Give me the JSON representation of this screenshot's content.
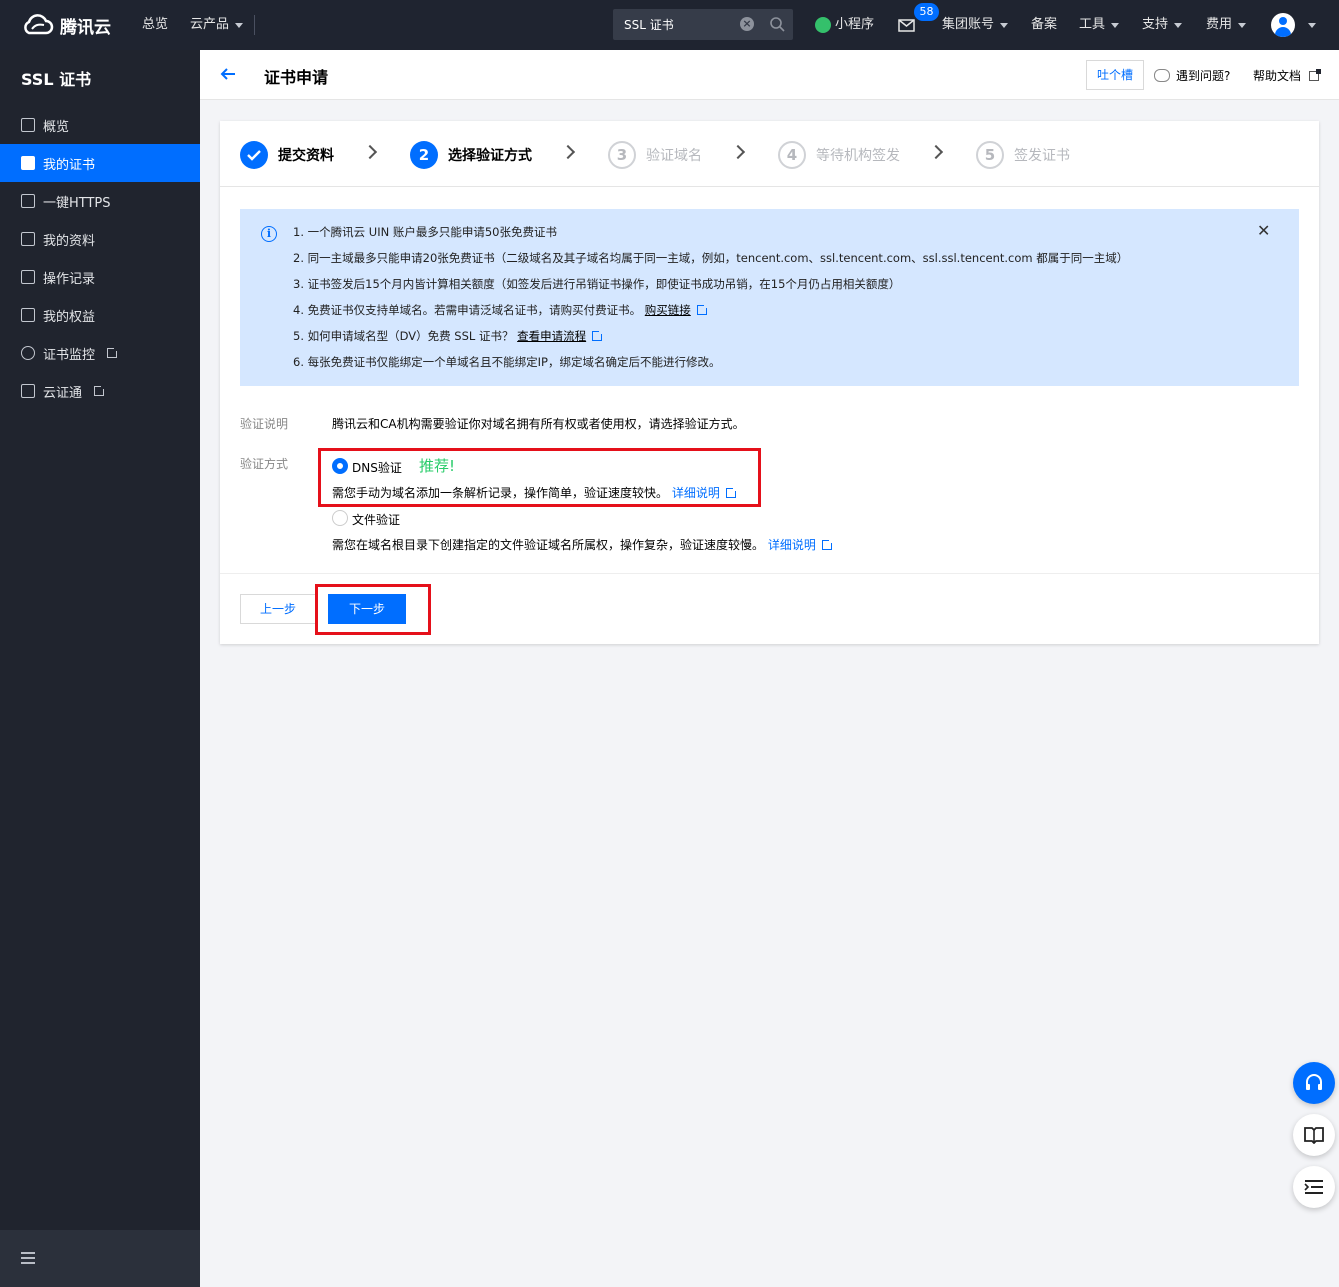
{
  "topbar": {
    "brand": "腾讯云",
    "nav": {
      "overview": "总览",
      "products": "云产品"
    },
    "search": {
      "value": "SSL 证书"
    },
    "miniprogram": "小程序",
    "mail_badge": "58",
    "group_account": "集团账号",
    "beian": "备案",
    "tools": "工具",
    "support": "支持",
    "billing": "费用"
  },
  "sidebar": {
    "title": "SSL 证书",
    "items": [
      {
        "label": "概览"
      },
      {
        "label": "我的证书"
      },
      {
        "label": "一键HTTPS"
      },
      {
        "label": "我的资料"
      },
      {
        "label": "操作记录"
      },
      {
        "label": "我的权益"
      },
      {
        "label": "证书监控"
      },
      {
        "label": "云证通"
      }
    ]
  },
  "header": {
    "title": "证书申请",
    "feedback": "吐个槽",
    "help_question": "遇到问题?",
    "help_doc": "帮助文档"
  },
  "steps": [
    {
      "num": "",
      "label": "提交资料"
    },
    {
      "num": "2",
      "label": "选择验证方式"
    },
    {
      "num": "3",
      "label": "验证域名"
    },
    {
      "num": "4",
      "label": "等待机构签发"
    },
    {
      "num": "5",
      "label": "签发证书"
    }
  ],
  "notice": {
    "line1": "1. 一个腾讯云 UIN 账户最多只能申请50张免费证书",
    "line2": "2. 同一主域最多只能申请20张免费证书（二级域名及其子域名均属于同一主域，例如，tencent.com、ssl.tencent.com、ssl.ssl.tencent.com 都属于同一主域）",
    "line3": "3. 证书签发后15个月内皆计算相关额度（如签发后进行吊销证书操作，即使证书成功吊销，在15个月仍占用相关额度）",
    "line4": "4. 免费证书仅支持单域名。若需申请泛域名证书，请购买付费证书。",
    "line4_link": "购买链接",
    "line5": "5. 如何申请域名型（DV）免费 SSL 证书？",
    "line5_link": "查看申请流程",
    "line6": "6. 每张免费证书仅能绑定一个单域名且不能绑定IP，绑定域名确定后不能进行修改。"
  },
  "form": {
    "desc_label": "验证说明",
    "desc_text": "腾讯云和CA机构需要验证你对域名拥有所有权或者使用权，请选择验证方式。",
    "method_label": "验证方式",
    "dns_label": "DNS验证",
    "recommend": "推荐!",
    "dns_desc": "需您手动为域名添加一条解析记录，操作简单，验证速度较快。",
    "detail_link": "详细说明",
    "file_label": "文件验证",
    "file_desc": "需您在域名根目录下创建指定的文件验证域名所属权，操作复杂，验证速度较慢。"
  },
  "actions": {
    "prev": "上一步",
    "next": "下一步"
  }
}
